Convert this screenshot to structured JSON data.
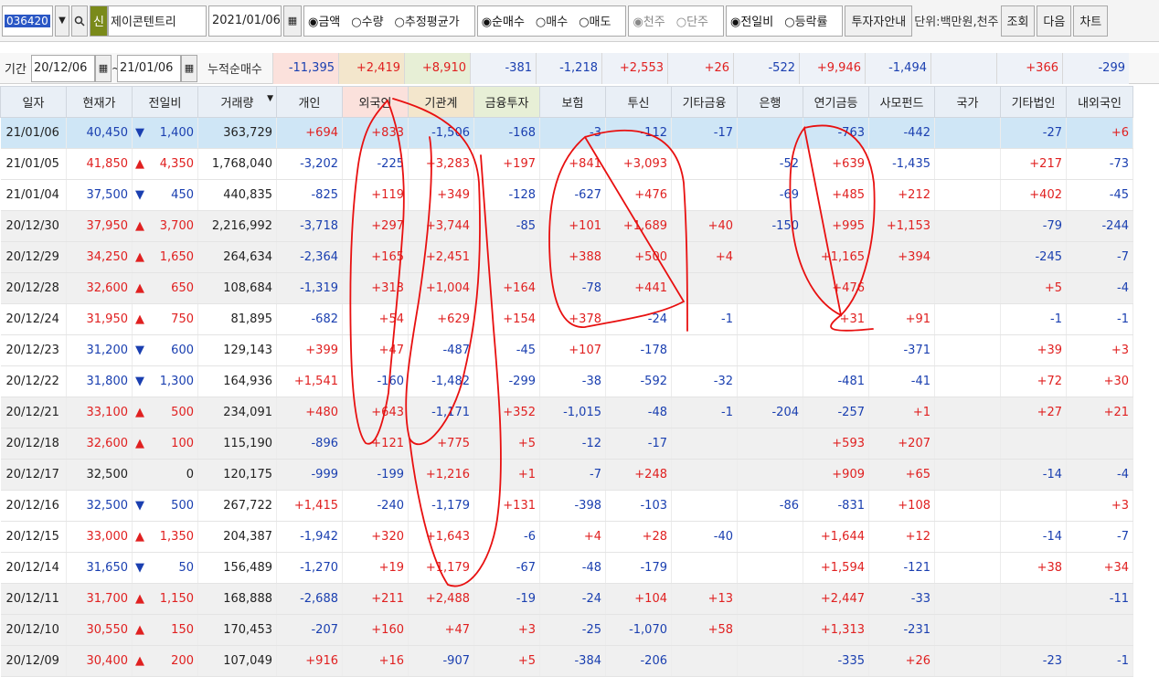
{
  "toolbar": {
    "code": "036420",
    "shin": "신",
    "name": "제이콘텐트리",
    "date": "2021/01/06",
    "group1": [
      "금액",
      "수량",
      "추정평균가"
    ],
    "group2": [
      "순매수",
      "매수",
      "매도"
    ],
    "group3": [
      "천주",
      "단주"
    ],
    "group4": [
      "전일비",
      "등락률"
    ],
    "guide_btn": "투자자안내",
    "unit_text": "단위:백만원,천주",
    "query_btn": "조회",
    "next_btn": "다음",
    "chart_btn": "차트"
  },
  "period": {
    "label": "기간",
    "from": "20/12/06",
    "tilde": "~",
    "to": "21/01/06",
    "cum_label": "누적순매수",
    "cum": [
      "-11,395",
      "+2,419",
      "+8,910",
      "-381",
      "-1,218",
      "+2,553",
      "+26",
      "-522",
      "+9,946",
      "-1,494",
      "",
      "+366",
      "-299"
    ]
  },
  "headers": [
    "일자",
    "현재가",
    "전일비",
    "거래량",
    "개인",
    "외국인",
    "기관계",
    "금융투자",
    "보험",
    "투신",
    "기타금융",
    "은행",
    "연기금등",
    "사모펀드",
    "국가",
    "기타법인",
    "내외국인"
  ],
  "colors": {
    "up": "#e02020",
    "down": "#1a3fb0",
    "annotation": "#e81010",
    "selected_row": "#cfe6f6"
  },
  "rows": [
    [
      "21/01/06",
      "40,450",
      "▼",
      "1,400",
      "363,729",
      "+694",
      "+833",
      "-1,506",
      "-168",
      "-3",
      "-112",
      "-17",
      "",
      "-763",
      "-442",
      "",
      "-27",
      "+6"
    ],
    [
      "21/01/05",
      "41,850",
      "▲",
      "4,350",
      "1,768,040",
      "-3,202",
      "-225",
      "+3,283",
      "+197",
      "+841",
      "+3,093",
      "",
      "-52",
      "+639",
      "-1,435",
      "",
      "+217",
      "-73"
    ],
    [
      "21/01/04",
      "37,500",
      "▼",
      "450",
      "440,835",
      "-825",
      "+119",
      "+349",
      "-128",
      "-627",
      "+476",
      "",
      "-69",
      "+485",
      "+212",
      "",
      "+402",
      "-45"
    ],
    [
      "20/12/30",
      "37,950",
      "▲",
      "3,700",
      "2,216,992",
      "-3,718",
      "+297",
      "+3,744",
      "-85",
      "+101",
      "+1,689",
      "+40",
      "-150",
      "+995",
      "+1,153",
      "",
      "-79",
      "-244"
    ],
    [
      "20/12/29",
      "34,250",
      "▲",
      "1,650",
      "264,634",
      "-2,364",
      "+165",
      "+2,451",
      "",
      "+388",
      "+500",
      "+4",
      "",
      "+1,165",
      "+394",
      "",
      "-245",
      "-7"
    ],
    [
      "20/12/28",
      "32,600",
      "▲",
      "650",
      "108,684",
      "-1,319",
      "+313",
      "+1,004",
      "+164",
      "-78",
      "+441",
      "",
      "",
      "+476",
      "",
      "",
      "+5",
      "-4"
    ],
    [
      "20/12/24",
      "31,950",
      "▲",
      "750",
      "81,895",
      "-682",
      "+54",
      "+629",
      "+154",
      "+378",
      "-24",
      "-1",
      "",
      "+31",
      "+91",
      "",
      "-1",
      "-1"
    ],
    [
      "20/12/23",
      "31,200",
      "▼",
      "600",
      "129,143",
      "+399",
      "+47",
      "-487",
      "-45",
      "+107",
      "-178",
      "",
      "",
      "",
      "-371",
      "",
      "+39",
      "+3"
    ],
    [
      "20/12/22",
      "31,800",
      "▼",
      "1,300",
      "164,936",
      "+1,541",
      "-160",
      "-1,482",
      "-299",
      "-38",
      "-592",
      "-32",
      "",
      "-481",
      "-41",
      "",
      "+72",
      "+30"
    ],
    [
      "20/12/21",
      "33,100",
      "▲",
      "500",
      "234,091",
      "+480",
      "+643",
      "-1,171",
      "+352",
      "-1,015",
      "-48",
      "-1",
      "-204",
      "-257",
      "+1",
      "",
      "+27",
      "+21"
    ],
    [
      "20/12/18",
      "32,600",
      "▲",
      "100",
      "115,190",
      "-896",
      "+121",
      "+775",
      "+5",
      "-12",
      "-17",
      "",
      "",
      "+593",
      "+207",
      "",
      "",
      ""
    ],
    [
      "20/12/17",
      "32,500",
      "",
      "0",
      "120,175",
      "-999",
      "-199",
      "+1,216",
      "+1",
      "-7",
      "+248",
      "",
      "",
      "+909",
      "+65",
      "",
      "-14",
      "-4"
    ],
    [
      "20/12/16",
      "32,500",
      "▼",
      "500",
      "267,722",
      "+1,415",
      "-240",
      "-1,179",
      "+131",
      "-398",
      "-103",
      "",
      "-86",
      "-831",
      "+108",
      "",
      "",
      "+3"
    ],
    [
      "20/12/15",
      "33,000",
      "▲",
      "1,350",
      "204,387",
      "-1,942",
      "+320",
      "+1,643",
      "-6",
      "+4",
      "+28",
      "-40",
      "",
      "+1,644",
      "+12",
      "",
      "-14",
      "-7"
    ],
    [
      "20/12/14",
      "31,650",
      "▼",
      "50",
      "156,489",
      "-1,270",
      "+19",
      "+1,179",
      "-67",
      "-48",
      "-179",
      "",
      "",
      "+1,594",
      "-121",
      "",
      "+38",
      "+34"
    ],
    [
      "20/12/11",
      "31,700",
      "▲",
      "1,150",
      "168,888",
      "-2,688",
      "+211",
      "+2,488",
      "-19",
      "-24",
      "+104",
      "+13",
      "",
      "+2,447",
      "-33",
      "",
      "",
      "-11"
    ],
    [
      "20/12/10",
      "30,550",
      "▲",
      "150",
      "170,453",
      "-207",
      "+160",
      "+47",
      "+3",
      "-25",
      "-1,070",
      "+58",
      "",
      "+1,313",
      "-231",
      "",
      "",
      ""
    ],
    [
      "20/12/09",
      "30,400",
      "▲",
      "200",
      "107,049",
      "+916",
      "+16",
      "-907",
      "+5",
      "-384",
      "-206",
      "",
      "",
      "-335",
      "+26",
      "",
      "-23",
      "-1"
    ]
  ]
}
